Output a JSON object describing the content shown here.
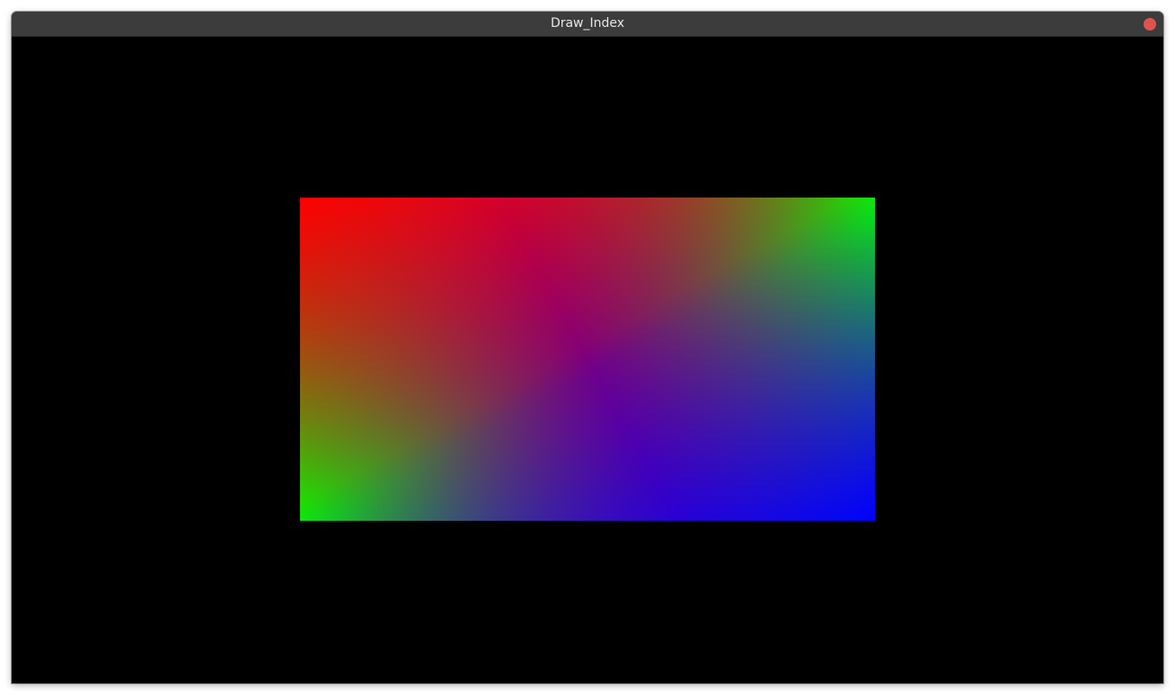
{
  "window": {
    "title": "Draw_Index",
    "close_color": "#e0534d"
  },
  "canvas": {
    "background": "#000000",
    "quad_corner_colors": {
      "top_left": "#ff0000",
      "top_right": "#00ff00",
      "bottom_left": "#00ff00",
      "bottom_right": "#0000ff"
    }
  }
}
